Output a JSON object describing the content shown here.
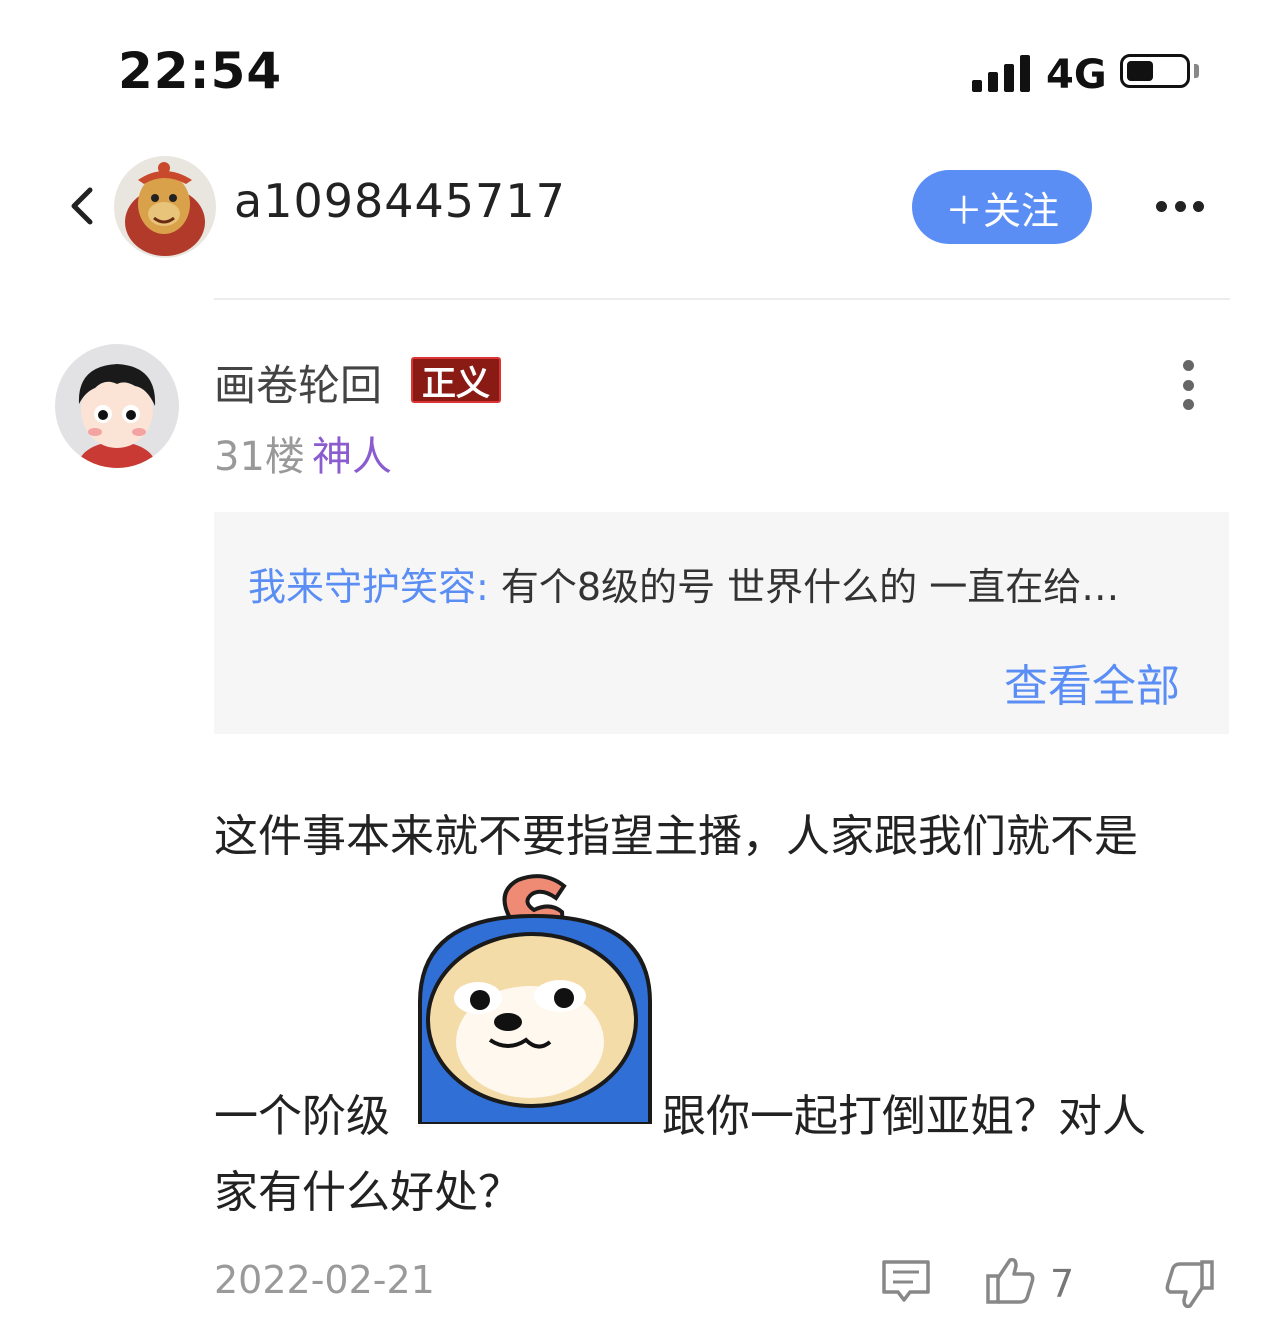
{
  "status_bar": {
    "time": "22:54",
    "network": "4G"
  },
  "header": {
    "username": "a1098445717",
    "follow_label": "＋关注"
  },
  "post": {
    "author": "画卷轮回",
    "badge": "正义",
    "floor": "31楼",
    "title": "神人",
    "quote": {
      "name": "我来守护笑容:",
      "text": " 有个8级的号 世界什么的 一直在给…",
      "view_all": "查看全部"
    },
    "content": {
      "line1": "这件事本来就不要指望主播，人家跟我们就不是",
      "line2a": "一个阶级",
      "line2b": "跟你一起打倒亚姐？对人",
      "line3": "家有什么好处？"
    },
    "date": "2022-02-21",
    "like_count": "7"
  },
  "colors": {
    "accent": "#5b8ef5",
    "title_purple": "#8b5bd0",
    "badge_red": "#8a1a14"
  },
  "icons": [
    "back-chevron-icon",
    "more-horizontal-icon",
    "more-vertical-icon",
    "comment-icon",
    "thumbs-up-icon",
    "thumbs-down-icon",
    "signal-icon",
    "battery-icon"
  ]
}
